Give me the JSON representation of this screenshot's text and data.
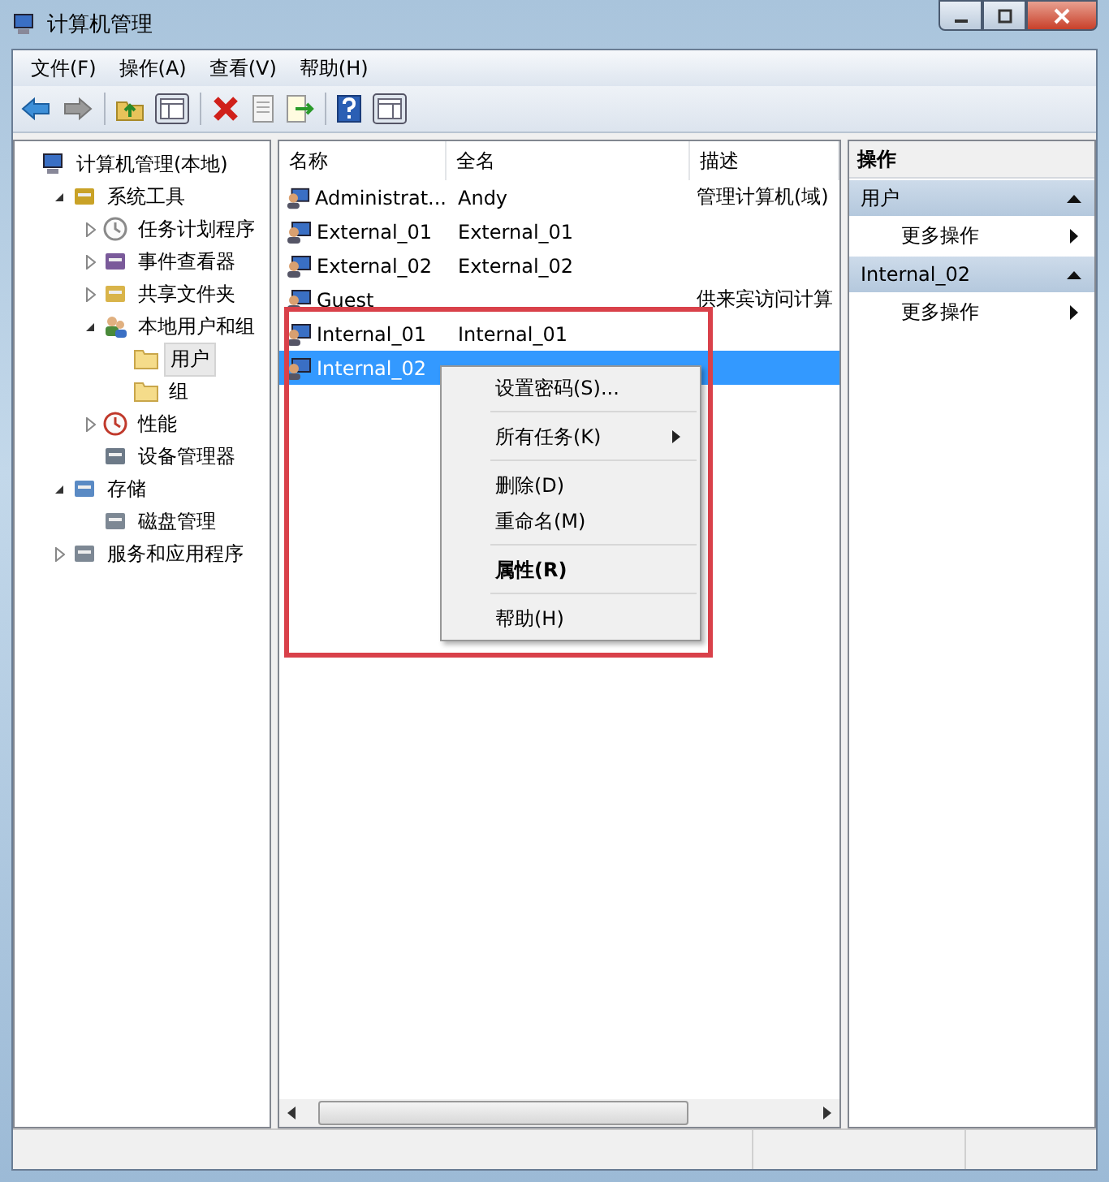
{
  "window": {
    "title": "计算机管理"
  },
  "menu": [
    "文件(F)",
    "操作(A)",
    "查看(V)",
    "帮助(H)"
  ],
  "tree": [
    {
      "label": "计算机管理(本地)",
      "kind": "computer",
      "selected": false,
      "children": [
        {
          "label": "系统工具",
          "kind": "tools",
          "selected": false,
          "expanded": true,
          "children": [
            {
              "label": "任务计划程序",
              "kind": "clock",
              "selected": false,
              "expanded": false
            },
            {
              "label": "事件查看器",
              "kind": "log",
              "selected": false,
              "expanded": false
            },
            {
              "label": "共享文件夹",
              "kind": "share",
              "selected": false,
              "expanded": false
            },
            {
              "label": "本地用户和组",
              "kind": "users",
              "selected": false,
              "expanded": true,
              "children": [
                {
                  "label": "用户",
                  "kind": "folder",
                  "selected": true
                },
                {
                  "label": "组",
                  "kind": "folder",
                  "selected": false
                }
              ]
            },
            {
              "label": "性能",
              "kind": "gauge",
              "selected": false,
              "expanded": false
            },
            {
              "label": "设备管理器",
              "kind": "device",
              "selected": false
            }
          ]
        },
        {
          "label": "存储",
          "kind": "storage",
          "selected": false,
          "expanded": true,
          "children": [
            {
              "label": "磁盘管理",
              "kind": "disk",
              "selected": false
            }
          ]
        },
        {
          "label": "服务和应用程序",
          "kind": "services",
          "selected": false,
          "expanded": false
        }
      ]
    }
  ],
  "table": {
    "columns": [
      "名称",
      "全名",
      "描述"
    ],
    "rows": [
      {
        "name": "Administrat...",
        "full_name": "Andy",
        "description": "管理计算机(域)",
        "selected": false
      },
      {
        "name": "External_01",
        "full_name": "External_01",
        "selected": false
      },
      {
        "name": "External_02",
        "full_name": "External_02",
        "selected": false
      },
      {
        "name": "Guest",
        "description": "供来宾访问计算",
        "selected": false
      },
      {
        "name": "Internal_01",
        "full_name": "Internal_01",
        "selected": false
      },
      {
        "name": "Internal_02",
        "selected": true
      }
    ]
  },
  "context_menu": [
    {
      "label": "设置密码(S)...",
      "separator_before": false,
      "submenu": false,
      "default": false
    },
    {
      "label": "所有任务(K)",
      "separator_before": true,
      "submenu": true,
      "default": false
    },
    {
      "label": "删除(D)",
      "separator_before": true,
      "submenu": false,
      "default": false
    },
    {
      "label": "重命名(M)",
      "separator_before": false,
      "submenu": false,
      "default": false
    },
    {
      "label": "属性(R)",
      "separator_before": true,
      "submenu": false,
      "default": true
    },
    {
      "label": "帮助(H)",
      "separator_before": true,
      "submenu": false,
      "default": false
    }
  ],
  "actions": {
    "title": "操作",
    "sections": [
      {
        "title": "用户",
        "items": [
          "更多操作"
        ]
      },
      {
        "title": "Internal_02",
        "items": [
          "更多操作"
        ]
      }
    ]
  }
}
